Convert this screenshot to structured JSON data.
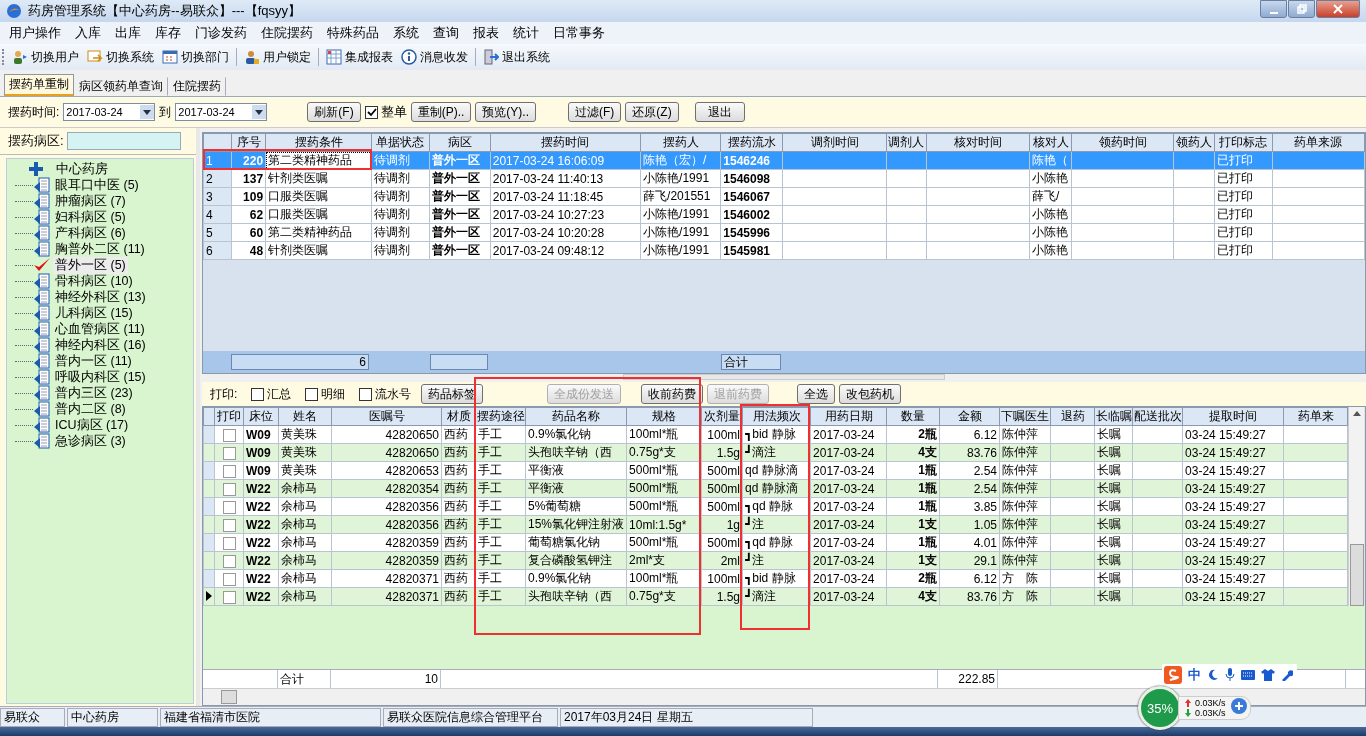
{
  "window": {
    "title": "药房管理系统【中心药房--易联众】---【fqsyy】"
  },
  "menu": [
    "用户操作",
    "入库",
    "出库",
    "库存",
    "门诊发药",
    "住院摆药",
    "特殊药品",
    "系统",
    "查询",
    "报表",
    "统计",
    "日常事务"
  ],
  "toolbar": [
    "切换用户",
    "切换系统",
    "切换部门",
    "用户锁定",
    "集成报表",
    "消息收发",
    "退出系统"
  ],
  "tabs": [
    {
      "label": "摆药单重制",
      "selected": true
    },
    {
      "label": "病区领药单查询",
      "selected": false
    },
    {
      "label": "住院摆药",
      "selected": false
    }
  ],
  "filter": {
    "label": "摆药时间:",
    "from": "2017-03-24",
    "to_label": "到",
    "to": "2017-03-24",
    "whole_order": {
      "label": "整单",
      "checked": true
    },
    "buttons": [
      {
        "label": "刷新(F)"
      },
      {
        "label": "重制(P).."
      },
      {
        "label": "预览(Y).."
      },
      {
        "label": "过滤(F)"
      },
      {
        "label": "还原(Z)"
      },
      {
        "label": "退出"
      }
    ]
  },
  "ward_filter": {
    "label": "摆药病区:"
  },
  "ward_tree": {
    "label": "中心药房",
    "children": [
      {
        "label": "眼耳口中医 (5)",
        "selected": false
      },
      {
        "label": "肿瘤病区 (7)",
        "selected": false
      },
      {
        "label": "妇科病区 (5)",
        "selected": false
      },
      {
        "label": "产科病区 (6)",
        "selected": false
      },
      {
        "label": "胸普外二区 (11)",
        "selected": false
      },
      {
        "label": "普外一区 (5)",
        "selected": true
      },
      {
        "label": "骨科病区 (10)",
        "selected": false
      },
      {
        "label": "神经外科区 (13)",
        "selected": false
      },
      {
        "label": "儿科病区 (15)",
        "selected": false
      },
      {
        "label": "心血管病区 (11)",
        "selected": false
      },
      {
        "label": "神经内科区 (16)",
        "selected": false
      },
      {
        "label": "普内一区 (11)",
        "selected": false
      },
      {
        "label": "呼吸内科区 (15)",
        "selected": false
      },
      {
        "label": "普内三区 (23)",
        "selected": false
      },
      {
        "label": "普内二区 (8)",
        "selected": false
      },
      {
        "label": "ICU病区 (17)",
        "selected": false
      },
      {
        "label": "急诊病区 (3)",
        "selected": false
      }
    ]
  },
  "orders_table": {
    "columns": [
      "序号",
      "摆药条件",
      "单据状态",
      "病区",
      "摆药时间",
      "摆药人",
      "摆药流水",
      "调剂时间",
      "调剂人",
      "核对时间",
      "核对人",
      "领药时间",
      "领药人",
      "打印标志",
      "药单来源"
    ],
    "rows": [
      {
        "row": "1",
        "selected": true,
        "cells": {
          "no": "220",
          "condition": "第二类精神药品",
          "status": "待调剂",
          "ward": "普外一区",
          "time": "2017-03-24 16:06:09",
          "person": "陈艳（宏）/",
          "serial": "1546246",
          "checker": "陈艳（",
          "print_flag": "已打印"
        }
      },
      {
        "row": "2",
        "selected": false,
        "cells": {
          "no": "137",
          "condition": "针剂类医嘱",
          "status": "待调剂",
          "ward": "普外一区",
          "time": "2017-03-24 11:40:13",
          "person": "小陈艳/1991",
          "serial": "1546098",
          "checker": "小陈艳",
          "print_flag": "已打印"
        }
      },
      {
        "row": "3",
        "selected": false,
        "cells": {
          "no": "109",
          "condition": "口服类医嘱",
          "status": "待调剂",
          "ward": "普外一区",
          "time": "2017-03-24 11:18:45",
          "person": "薛飞/201551",
          "serial": "1546067",
          "checker": "薛飞/",
          "print_flag": "已打印"
        }
      },
      {
        "row": "4",
        "selected": false,
        "cells": {
          "no": "62",
          "condition": "口服类医嘱",
          "status": "待调剂",
          "ward": "普外一区",
          "time": "2017-03-24 10:27:23",
          "person": "小陈艳/1991",
          "serial": "1546002",
          "checker": "小陈艳",
          "print_flag": "已打印"
        }
      },
      {
        "row": "5",
        "selected": false,
        "cells": {
          "no": "60",
          "condition": "第二类精神药品",
          "status": "待调剂",
          "ward": "普外一区",
          "time": "2017-03-24 10:20:28",
          "person": "小陈艳/1991",
          "serial": "1545996",
          "checker": "小陈艳",
          "print_flag": "已打印"
        }
      },
      {
        "row": "6",
        "selected": false,
        "cells": {
          "no": "48",
          "condition": "针剂类医嘱",
          "status": "待调剂",
          "ward": "普外一区",
          "time": "2017-03-24 09:48:12",
          "person": "小陈艳/1991",
          "serial": "1545981",
          "checker": "小陈艳",
          "print_flag": "已打印"
        }
      }
    ],
    "footer": {
      "count": "6",
      "total_label": "合计"
    }
  },
  "print_bar": {
    "label": "打印:",
    "options": [
      {
        "label": "汇总",
        "checked": false
      },
      {
        "label": "明细",
        "checked": false
      },
      {
        "label": "流水号",
        "checked": false
      }
    ],
    "buttons": [
      {
        "label": "药品标签",
        "disabled": false
      },
      {
        "label": "全成份发送",
        "disabled": true
      },
      {
        "label": "收前药费",
        "disabled": false
      },
      {
        "label": "退前药费",
        "disabled": true
      },
      {
        "label": "全选",
        "disabled": false
      },
      {
        "label": "改包药机",
        "disabled": false
      }
    ]
  },
  "items_table": {
    "columns": [
      "打印",
      "床位",
      "姓名",
      "医嘱号",
      "材质",
      "摆药途径",
      "药品名称",
      "规格",
      "次剂量",
      "用法频次",
      "用药日期",
      "数量",
      "金额",
      "下嘱医生",
      "退药",
      "长临嘱",
      "配送批次",
      "提取时间",
      "药单来"
    ],
    "rows": [
      {
        "selected": false,
        "checked": false,
        "cells": {
          "bed": "W09",
          "name": "黄美珠",
          "order_no": "42820650",
          "material": "西药",
          "route": "手工",
          "drug": "0.9%氯化钠",
          "spec": "100ml*瓶",
          "dose": "100ml",
          "usage": "┓bid 静脉",
          "date": "2017-03-24",
          "qty": "2瓶",
          "amount": "6.12",
          "doctor": "陈仲萍",
          "long": "长嘱",
          "fetch": "03-24 15:49:27"
        }
      },
      {
        "selected": false,
        "checked": false,
        "cells": {
          "bed": "W09",
          "name": "黄美珠",
          "order_no": "42820650",
          "material": "西药",
          "route": "手工",
          "drug": "头孢呋辛钠（西",
          "spec": "0.75g*支",
          "dose": "1.5g",
          "usage": "┛滴注",
          "date": "2017-03-24",
          "qty": "4支",
          "amount": "83.76",
          "doctor": "陈仲萍",
          "long": "长嘱",
          "fetch": "03-24 15:49:27"
        }
      },
      {
        "selected": false,
        "checked": false,
        "cells": {
          "bed": "W09",
          "name": "黄美珠",
          "order_no": "42820653",
          "material": "西药",
          "route": "手工",
          "drug": "平衡液",
          "spec": "500ml*瓶",
          "dose": "500ml",
          "usage": "qd 静脉滴",
          "date": "2017-03-24",
          "qty": "1瓶",
          "amount": "2.54",
          "doctor": "陈仲萍",
          "long": "长嘱",
          "fetch": "03-24 15:49:27"
        }
      },
      {
        "selected": false,
        "checked": false,
        "cells": {
          "bed": "W22",
          "name": "余柿马",
          "order_no": "42820354",
          "material": "西药",
          "route": "手工",
          "drug": "平衡液",
          "spec": "500ml*瓶",
          "dose": "500ml",
          "usage": "qd 静脉滴",
          "date": "2017-03-24",
          "qty": "1瓶",
          "amount": "2.54",
          "doctor": "陈仲萍",
          "long": "长嘱",
          "fetch": "03-24 15:49:27"
        }
      },
      {
        "selected": false,
        "checked": false,
        "cells": {
          "bed": "W22",
          "name": "余柿马",
          "order_no": "42820356",
          "material": "西药",
          "route": "手工",
          "drug": "5%葡萄糖",
          "spec": "500ml*瓶",
          "dose": "500ml",
          "usage": "┓qd 静脉",
          "date": "2017-03-24",
          "qty": "1瓶",
          "amount": "3.85",
          "doctor": "陈仲萍",
          "long": "长嘱",
          "fetch": "03-24 15:49:27"
        }
      },
      {
        "selected": false,
        "checked": false,
        "cells": {
          "bed": "W22",
          "name": "余柿马",
          "order_no": "42820356",
          "material": "西药",
          "route": "手工",
          "drug": "15%氯化钾注射液",
          "spec": "10ml:1.5g*",
          "dose": "1g",
          "usage": "┛注",
          "date": "2017-03-24",
          "qty": "1支",
          "amount": "1.05",
          "doctor": "陈仲萍",
          "long": "长嘱",
          "fetch": "03-24 15:49:27"
        }
      },
      {
        "selected": false,
        "checked": false,
        "cells": {
          "bed": "W22",
          "name": "余柿马",
          "order_no": "42820359",
          "material": "西药",
          "route": "手工",
          "drug": "葡萄糖氯化钠",
          "spec": "500ml*瓶",
          "dose": "500ml",
          "usage": "┓qd 静脉",
          "date": "2017-03-24",
          "qty": "1瓶",
          "amount": "4.01",
          "doctor": "陈仲萍",
          "long": "长嘱",
          "fetch": "03-24 15:49:27"
        }
      },
      {
        "selected": false,
        "checked": false,
        "cells": {
          "bed": "W22",
          "name": "余柿马",
          "order_no": "42820359",
          "material": "西药",
          "route": "手工",
          "drug": "复合磷酸氢钾注",
          "spec": "2ml*支",
          "dose": "2ml",
          "usage": "┛注",
          "date": "2017-03-24",
          "qty": "1支",
          "amount": "29.1",
          "doctor": "陈仲萍",
          "long": "长嘱",
          "fetch": "03-24 15:49:27"
        }
      },
      {
        "selected": false,
        "checked": false,
        "cells": {
          "bed": "W22",
          "name": "余柿马",
          "order_no": "42820371",
          "material": "西药",
          "route": "手工",
          "drug": "0.9%氯化钠",
          "spec": "100ml*瓶",
          "dose": "100ml",
          "usage": "┓bid 静脉",
          "date": "2017-03-24",
          "qty": "2瓶",
          "amount": "6.12",
          "doctor": "方　陈",
          "long": "长嘱",
          "fetch": "03-24 15:49:27"
        }
      },
      {
        "selected": true,
        "checked": false,
        "cells": {
          "bed": "W22",
          "name": "余柿马",
          "order_no": "42820371",
          "material": "西药",
          "route": "手工",
          "drug": "头孢呋辛钠（西",
          "spec": "0.75g*支",
          "dose": "1.5g",
          "usage": "┛滴注",
          "date": "2017-03-24",
          "qty": "4支",
          "amount": "83.76",
          "doctor": "方　陈",
          "long": "长嘱",
          "fetch": "03-24 15:49:27"
        }
      }
    ],
    "footer": {
      "total_label": "合计",
      "count": "10",
      "amount": "222.85"
    }
  },
  "status_bar": [
    "易联众",
    "中心药房",
    "福建省福清市医院",
    "易联众医院信息综合管理平台",
    "2017年03月24日 星期五"
  ],
  "ime": {
    "mode": "中"
  },
  "net_widget": {
    "percent": "35%",
    "upload": "0.03K/s",
    "download": "0.03K/s"
  }
}
